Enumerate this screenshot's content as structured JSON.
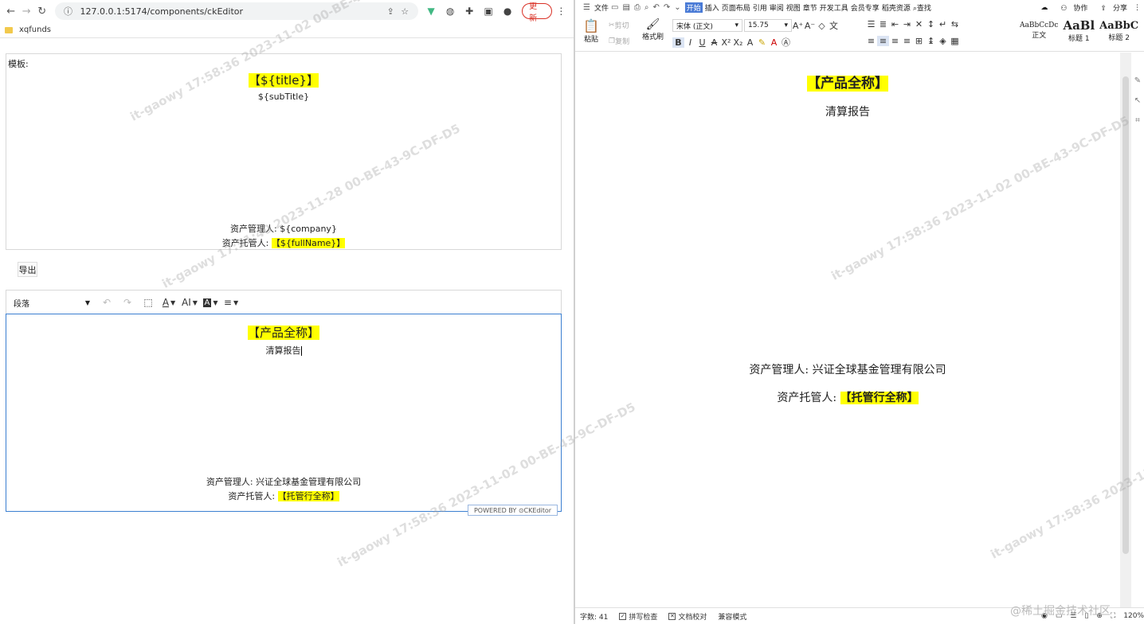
{
  "browser": {
    "url": "127.0.0.1:5174/components/ckEditor",
    "update_label": "更新",
    "bookmark": "xqfunds"
  },
  "template": {
    "label": "模板:",
    "title": "【${title}】",
    "subtitle": "${subTitle}",
    "manager": "资产管理人: ${company}",
    "custodian_prefix": "资产托管人: ",
    "custodian_value": "【${fullName}】"
  },
  "export_label": "导出",
  "ck_toolbar": {
    "paragraph_select": "段落"
  },
  "editor": {
    "title": "【产品全称】",
    "subtitle": "清算报告",
    "manager": "资产管理人: 兴证全球基金管理有限公司",
    "custodian_prefix": "资产托管人: ",
    "custodian_value": "【托管行全称】",
    "powered_by": "POWERED BY ⊙CKEditor"
  },
  "wps": {
    "menu": [
      "文件",
      "开始",
      "插入",
      "页面布局",
      "引用",
      "审阅",
      "视图",
      "章节",
      "开发工具",
      "会员专享",
      "稻壳资源"
    ],
    "search": "查找",
    "collab": "协作",
    "share": "分享",
    "ribbon": {
      "paste": "粘贴",
      "cut": "剪切",
      "copy": "复制",
      "format_painter": "格式刷",
      "font": "宋体 (正文)",
      "size": "15.75",
      "styles": [
        {
          "sample": "AaBbCcDc",
          "name": "正文"
        },
        {
          "sample": "AaBl",
          "name": "标题 1"
        },
        {
          "sample": "AaBbC",
          "name": "标题 2"
        }
      ]
    },
    "doc": {
      "title": "【产品全称】",
      "subtitle": "清算报告",
      "manager": "资产管理人: 兴证全球基金管理有限公司",
      "custodian_prefix": "资产托管人: ",
      "custodian_value": "【托管行全称】"
    },
    "status": {
      "word_count": "字数: 41",
      "spell_check": "拼写检查",
      "proofread": "文档校对",
      "compat_mode": "兼容模式",
      "zoom": "120%"
    }
  },
  "watermark_text": "it-gaowy 17:58:36 2023-11-02 00-BE-43-9C-DF-D5",
  "watermark_text2": "it-gaowy 17:51:40 2023-11-28 00-BE-43-9C-DF-D5",
  "site_mark": "@稀土掘金技术社区",
  "colors": {
    "highlight": "#ffff00",
    "editor_border": "#3b7fd1",
    "wps_active": "#4a7bd6"
  }
}
